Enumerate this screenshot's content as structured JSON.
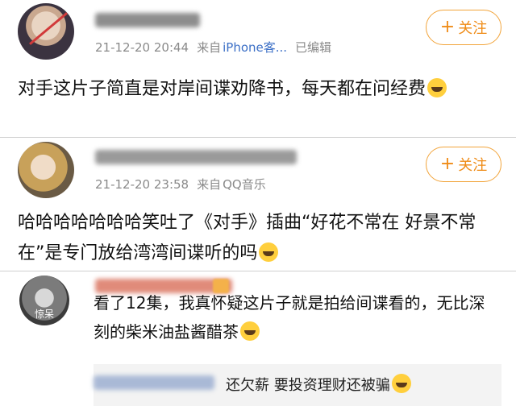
{
  "posts": [
    {
      "timestamp": "21-12-20 20:44",
      "source_prefix": "来自",
      "source_device": "iPhone客...",
      "edited": "已编辑",
      "follow_label": "关注",
      "text": "对手这片子简直是对岸间谍劝降书，每天都在问经费"
    },
    {
      "timestamp": "21-12-20 23:58",
      "source_prefix": "来自",
      "source_device": "QQ音乐",
      "follow_label": "关注",
      "text": "哈哈哈哈哈哈哈笑吐了《对手》插曲“好花不常在 好景不常在”是专门放给湾湾间谍听的吗"
    }
  ],
  "comment": {
    "avatar_label": "惊呆",
    "text": "看了12集，我真怀疑这片子就是拍给间谍看的，无比深刻的柴米油盐酱醋茶",
    "reply": {
      "text": "还欠薪 要投资理财还被骗"
    }
  },
  "colors": {
    "accent": "#ef8b16",
    "link": "#3b6fc6",
    "meta": "#8a8a8a"
  },
  "icons": {
    "emoji": "laugh-cry-emoji",
    "plus": "plus-icon"
  }
}
